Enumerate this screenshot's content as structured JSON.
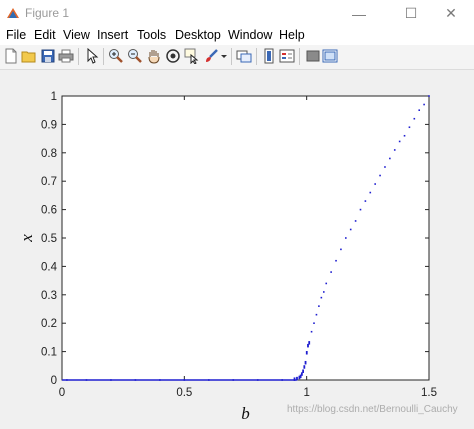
{
  "window": {
    "title": "Figure 1",
    "controls": {
      "minimize": "—",
      "maximize": "☐",
      "close": "✕"
    }
  },
  "menubar": {
    "items": [
      {
        "id": "file",
        "label": "File"
      },
      {
        "id": "edit",
        "label": "Edit"
      },
      {
        "id": "view",
        "label": "View"
      },
      {
        "id": "insert",
        "label": "Insert"
      },
      {
        "id": "tools",
        "label": "Tools"
      },
      {
        "id": "desktop",
        "label": "Desktop"
      },
      {
        "id": "window",
        "label": "Window"
      },
      {
        "id": "help",
        "label": "Help"
      }
    ]
  },
  "toolbar": {
    "icons": [
      "new-figure-icon",
      "open-file-icon",
      "save-icon",
      "print-icon",
      "edit-plot-arrow-icon",
      "zoom-in-icon",
      "zoom-out-icon",
      "pan-hand-icon",
      "rotate-3d-icon",
      "data-cursor-icon",
      "brush-icon",
      "brush-dropdown-icon",
      "link-plot-icon",
      "colorbar-icon",
      "legend-icon",
      "hide-plot-tools-icon",
      "show-plot-tools-icon"
    ]
  },
  "watermark": "https://blog.csdn.net/Bernoulli_Cauchy",
  "chart_data": {
    "type": "scatter",
    "title": "",
    "xlabel": "b",
    "ylabel": "x",
    "xlim": [
      0,
      1.5
    ],
    "ylim": [
      0,
      1
    ],
    "xticks": [
      "0",
      "0.5",
      "1",
      "1.5"
    ],
    "yticks": [
      "0",
      "0.1",
      "0.2",
      "0.3",
      "0.4",
      "0.5",
      "0.6",
      "0.7",
      "0.8",
      "0.9",
      "1"
    ],
    "grid": false,
    "marker_color": "#1f1fd0",
    "series": [
      {
        "x": [
          0.02,
          0.1,
          0.2,
          0.3,
          0.4,
          0.5,
          0.6,
          0.7,
          0.8,
          0.9,
          0.95,
          0.96,
          0.97,
          0.975,
          0.98,
          0.985,
          0.99,
          0.995,
          1.0,
          1.005,
          1.01,
          1.02,
          1.03,
          1.04,
          1.05,
          1.06,
          1.07,
          1.08,
          1.1,
          1.12,
          1.14,
          1.16,
          1.18,
          1.2,
          1.22,
          1.24,
          1.26,
          1.28,
          1.3,
          1.32,
          1.34,
          1.36,
          1.38,
          1.4,
          1.42,
          1.44,
          1.46,
          1.48,
          1.5
        ],
        "y": [
          0.0,
          0.0,
          0.0,
          0.0,
          0.0,
          0.0,
          0.0,
          0.0,
          0.0,
          0.0,
          0.002,
          0.004,
          0.008,
          0.012,
          0.02,
          0.03,
          0.045,
          0.06,
          0.095,
          0.12,
          0.13,
          0.17,
          0.2,
          0.23,
          0.26,
          0.29,
          0.31,
          0.34,
          0.38,
          0.42,
          0.46,
          0.5,
          0.53,
          0.56,
          0.6,
          0.63,
          0.66,
          0.69,
          0.72,
          0.75,
          0.78,
          0.81,
          0.84,
          0.86,
          0.89,
          0.92,
          0.95,
          0.97,
          1.0
        ]
      }
    ]
  }
}
